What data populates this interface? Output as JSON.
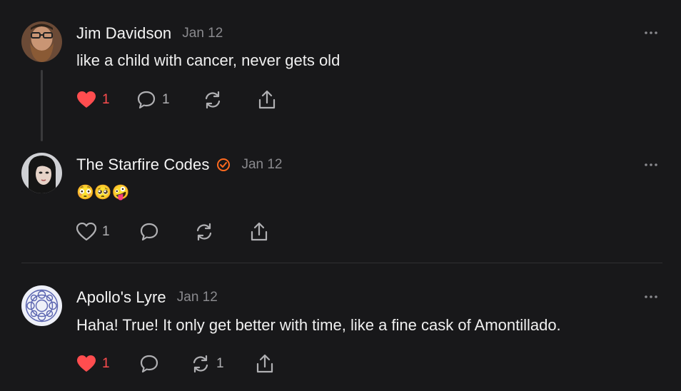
{
  "posts": [
    {
      "author": "Jim Davidson",
      "date": "Jan 12",
      "text": "like a child with cancer, never gets old",
      "liked": true,
      "like_count": "1",
      "reply_count": "1",
      "repost_count": ""
    },
    {
      "author": "The Starfire Codes",
      "date": "Jan 12",
      "text": "😳🥺🤪",
      "verified": true,
      "liked": false,
      "like_count": "1",
      "reply_count": "",
      "repost_count": ""
    },
    {
      "author": "Apollo's Lyre",
      "date": "Jan 12",
      "text": "Haha! True! It only get better with time, like a fine cask of Amontillado.",
      "liked": true,
      "like_count": "1",
      "reply_count": "",
      "repost_count": "1"
    }
  ],
  "icons": {
    "like": "heart-icon",
    "reply": "comment-icon",
    "repost": "repost-icon",
    "share": "share-icon",
    "more": "more-horizontal-icon",
    "verified": "verified-check-icon"
  },
  "colors": {
    "background": "#18181a",
    "like_active": "#ff4d4f",
    "verified": "#ff6a1f",
    "muted": "#8a8a8e"
  }
}
